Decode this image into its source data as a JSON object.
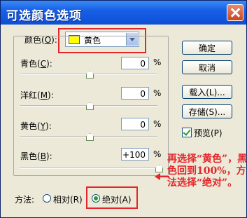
{
  "window": {
    "title": "可选颜色选项"
  },
  "colors_row": {
    "label": "颜色(",
    "hotkey": "O",
    "label_end": "):",
    "selected": "黄色"
  },
  "sliders": [
    {
      "label": "青色(",
      "hotkey": "C",
      "label_end": "):",
      "value": "0",
      "unit": "%",
      "level": 0.5
    },
    {
      "label": "洋红(",
      "hotkey": "M",
      "label_end": "):",
      "value": "0",
      "unit": "%",
      "level": 0.5
    },
    {
      "label": "黄色(",
      "hotkey": "Y",
      "label_end": "):",
      "value": "0",
      "unit": "%",
      "level": 0.5
    },
    {
      "label": "黑色(",
      "hotkey": "B",
      "label_end": "):",
      "value": "+100",
      "unit": "%",
      "level": 1.0
    }
  ],
  "buttons": {
    "ok": "确定",
    "cancel": "取消",
    "load": "载入(L)...",
    "save": "存储(S)...",
    "preview_label": "预览(P)"
  },
  "method": {
    "label": "方法:",
    "relative": "相对(R)",
    "absolute": "绝对(A)",
    "selected": "absolute"
  },
  "annotation": "再选择“黄色”，黑色回到100%，方法选择“绝对”。",
  "accent_colors": {
    "highlight": "#e4262a",
    "titlebar": "#1760e6"
  }
}
